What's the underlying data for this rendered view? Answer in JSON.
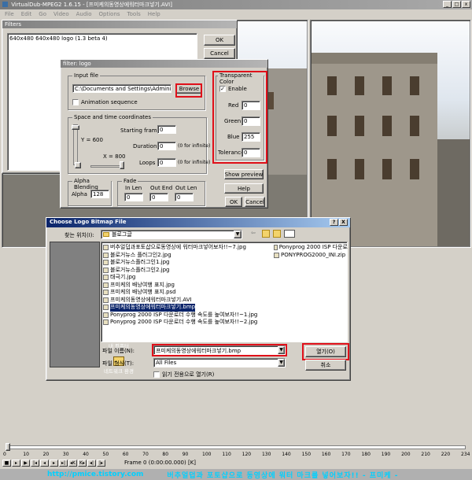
{
  "app": {
    "title": "VirtualDub-MPEG2 1.6.15 - [프미케의동영상에워터마크넣기.AVI]",
    "menu": [
      "File",
      "Edit",
      "Go",
      "Video",
      "Audio",
      "Options",
      "Tools",
      "Help"
    ]
  },
  "filters_window": {
    "title": "Filters",
    "list_item": "640x480  640x480  logo (1.3 beta 4)",
    "ok": "OK",
    "cancel": "Cancel"
  },
  "logo_dialog": {
    "title": "filter: logo",
    "input_file": {
      "label": "Input file",
      "path": "C:\\Documents and Settings\\Administrator\\",
      "browse": "Browse",
      "animation": "Animation sequence"
    },
    "space_time": {
      "label": "Space and time coordinates",
      "y_label": "Y = 600",
      "x_label": "X = 800",
      "start_frame_label": "Starting frame",
      "start_frame": "0",
      "duration_label": "Duration",
      "duration": "0",
      "duration_hint": "(0 for infinite)",
      "loops_label": "Loops",
      "loops": "0",
      "loops_hint": "(0 for infinite)"
    },
    "alpha": {
      "label": "Alpha Blending",
      "alpha_label": "Alpha",
      "alpha": "128"
    },
    "fade": {
      "label": "Fade",
      "in_len_label": "In Len",
      "out_end_label": "Out End",
      "out_len_label": "Out Len",
      "in_len": "0",
      "out_end": "0",
      "out_len": "0"
    },
    "transparent": {
      "label": "Transparent Color",
      "enable": "Enable",
      "enabled": true,
      "red_label": "Red",
      "red": "0",
      "green_label": "Green",
      "green": "0",
      "blue_label": "Blue",
      "blue": "255",
      "tolerance_label": "Tolerance",
      "tolerance": "0"
    },
    "show_preview": "Show preview",
    "help": "Help",
    "ok": "OK",
    "cancel": "Cancel"
  },
  "file_dialog": {
    "title": "Choose Logo Bitmap File",
    "help_btn": "?",
    "close_btn": "X",
    "look_in_label": "찾는 위치(I):",
    "look_in_value": "블로그글",
    "places": [
      {
        "label": "최근 파일",
        "icon": "recent-files-icon"
      },
      {
        "label": "바탕 화면",
        "icon": "desktop-icon"
      },
      {
        "label": "내 문서",
        "icon": "my-documents-icon"
      },
      {
        "label": "내 컴퓨터",
        "icon": "my-computer-icon"
      },
      {
        "label": "네트워크 환경",
        "icon": "network-icon"
      }
    ],
    "files_col1": [
      "버추얼덥과포토샵으로동영상에 워터마크넣어보자!!~7.jpg",
      "블로거뉴스 플러그인2.jpg",
      "블로거뉴스플러그인1.jpg",
      "블로거뉴스플러그인2.jpg",
      "태극기.jpg",
      "프미케의 배낭여행 표지.jpg",
      "프미케의 배낭여행 표지.psd",
      "프미케의동영상에워터마크넣기.AVI",
      "프미케의동영상에워터마크넣기.bmp",
      "Ponyprog 2000 ISP 다운로더 수행 속도를 높여보자!!~1.jpg",
      "Ponyprog 2000 ISP 다운로더 수행 속도를 높여보자!!~2.jpg"
    ],
    "selected_index": 8,
    "files_col2": [
      "Ponyprog 2000 ISP 다운로",
      "PONYPROG2000_INI.zip"
    ],
    "filename_label": "파일 이름(N):",
    "filename_value": "프미케의동영상에워터마크넣기.bmp",
    "filetype_label": "파일 형식(T):",
    "filetype_value": "All Files",
    "readonly_label": "읽기 전용으로 열기(R)",
    "open_btn": "열기(O)",
    "cancel_btn": "취소"
  },
  "timeline": {
    "ticks": [
      "0",
      "10",
      "20",
      "30",
      "40",
      "50",
      "60",
      "70",
      "80",
      "90",
      "100",
      "110",
      "120",
      "130",
      "140",
      "150",
      "160",
      "170",
      "180",
      "190",
      "200",
      "210",
      "220",
      "234"
    ],
    "frame_status": "Frame 0 (0:00:00.000) [K]"
  },
  "footer": {
    "url": "http://pmice.tistory.com",
    "caption": "버추얼덥과 포토샵으로 동영상에 워터 마크를 넣어보자!!  - 프미케 -"
  }
}
